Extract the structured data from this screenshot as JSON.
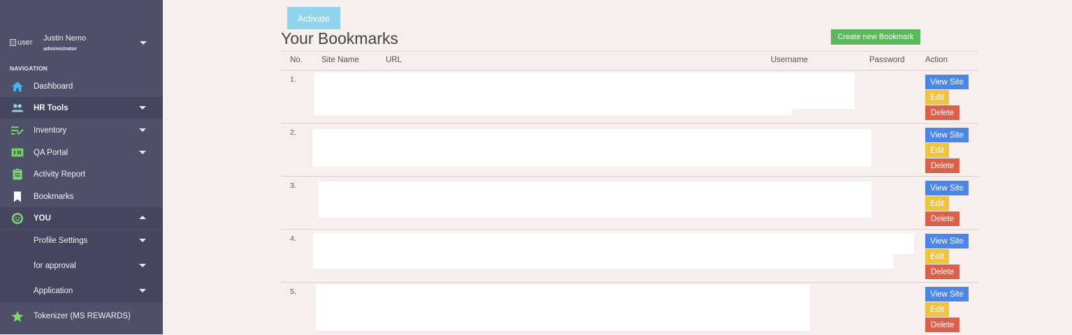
{
  "sidebar": {
    "user": {
      "image_alt": "user",
      "name": "Justin Nemo",
      "role": "administrator"
    },
    "nav_heading": "NAVIGATION",
    "items": [
      {
        "label": "Dashboard",
        "icon": "home-icon",
        "icon_color": "#3fb6ef"
      },
      {
        "label": "HR Tools",
        "icon": "users-icon",
        "icon_color": "#8fd3ee"
      },
      {
        "label": "Inventory",
        "icon": "checklist-icon",
        "icon_color": "#7ed96b"
      },
      {
        "label": "QA Portal",
        "icon": "hd-badge-icon",
        "icon_color": "#6fcf5b"
      },
      {
        "label": "Activity Report",
        "icon": "clipboard-icon",
        "icon_color": "#7ed96b"
      },
      {
        "label": "Bookmarks",
        "icon": "bookmark-icon",
        "icon_color": "#ffffff"
      },
      {
        "label": "YOU",
        "icon": "face-icon",
        "icon_color": "#7ed96b"
      },
      {
        "label": "Profile Settings"
      },
      {
        "label": "for approval"
      },
      {
        "label": "Application"
      },
      {
        "label": "Tokenizer (MS REWARDS)",
        "icon": "star-icon",
        "icon_color": "#7ed96b"
      }
    ]
  },
  "main": {
    "activate_label": "Activate",
    "title": "Your Bookmarks",
    "create_label": "Create new Bookmark",
    "columns": [
      "No.",
      "Site Name",
      "URL",
      "Username",
      "Password",
      "Action"
    ],
    "rows": [
      {
        "no": "1."
      },
      {
        "no": "2."
      },
      {
        "no": "3."
      },
      {
        "no": "4."
      },
      {
        "no": "5."
      }
    ],
    "row_actions": {
      "view": "View Site",
      "edit": "Edit",
      "delete": "Delete"
    }
  },
  "colors": {
    "sidebar_bg": "#4d5068",
    "page_bg": "#f7eeee",
    "view_button": "#4a86e8",
    "edit_button": "#f0c33c",
    "delete_button": "#d9614b",
    "create_button": "#5cb85c",
    "activate_button": "#8fd3ee"
  }
}
